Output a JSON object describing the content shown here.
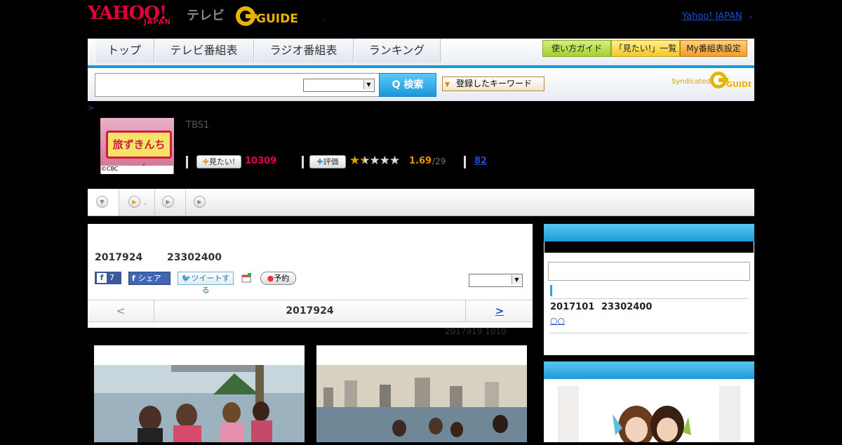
{
  "header": {
    "logo_yahoo": "YAHOO!",
    "logo_japan": "JAPAN",
    "logo_tv": "テレビ",
    "logo_gguide": "G-GUIDE",
    "yahoo_japan_link": "Yahoo! JAPAN",
    "separator": ",",
    "dot": "."
  },
  "nav": {
    "tabs": [
      "トップ",
      "テレビ番組表",
      "ラジオ番組表",
      "ランキング"
    ],
    "right_buttons": [
      "使い方ガイド",
      "「見たい!」一覧",
      "My番組表設定"
    ]
  },
  "search": {
    "button_label": "Q 検索",
    "keyword_button": "登録したキーワード",
    "syndicated": "Syndicated"
  },
  "program": {
    "breadcrumb": ">",
    "thumbnail_title": "旅ずきんちゃん",
    "thumbnail_caption": "©CBC",
    "channel": "TBS1",
    "mitai_label": "見たい!",
    "mitai_count": "10309",
    "rate_label": "評価",
    "stars": "★★☆☆☆",
    "rating": "1.69",
    "rating_count": "/29",
    "comments": "82"
  },
  "tabs_bar": {
    "tab2_suffix": "."
  },
  "episode": {
    "date": "2017924",
    "time": "23302400",
    "fb_like": "7",
    "fb_share": "シェア",
    "tweet": "ツイートする",
    "yoyaku": "予約",
    "pager_prev": "<",
    "pager_date": "2017924",
    "pager_next": ">",
    "updated": "2017919  1010"
  },
  "side": {
    "date": "2017101",
    "time": "23302400",
    "link": "○○"
  },
  "colors": {
    "accent_blue": "#1a9ad8",
    "mitai_pink": "#e60058",
    "rating_orange": "#e69800",
    "yahoo_red": "#e6003b"
  }
}
